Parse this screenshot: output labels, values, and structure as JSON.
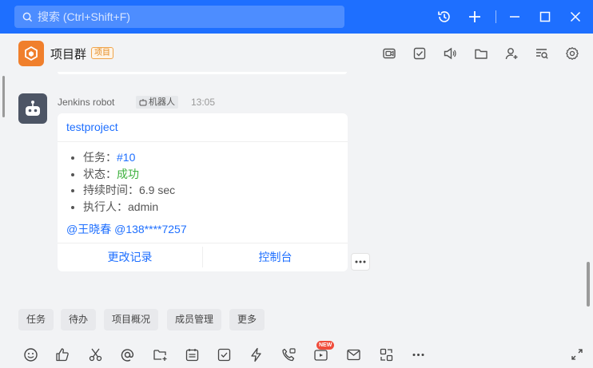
{
  "titlebar": {
    "search_placeholder": "搜索 (Ctrl+Shift+F)",
    "icons": [
      "history-icon",
      "plus-icon",
      "minimize-icon",
      "maximize-icon",
      "close-icon"
    ]
  },
  "header": {
    "group_name": "项目群",
    "group_badge": "项目",
    "icons": [
      "screen-share-icon",
      "task-check-icon",
      "announcement-icon",
      "folder-icon",
      "add-member-icon",
      "search-history-icon",
      "settings-icon"
    ]
  },
  "message": {
    "sender": "Jenkins robot",
    "robot_tag": "机器人",
    "time": "13:05",
    "card": {
      "title": "testproject",
      "items": [
        {
          "label": "任务：",
          "value": "#10"
        },
        {
          "label": "状态：",
          "value": "成功"
        },
        {
          "label": "持续时间：6.9 sec",
          "value": ""
        },
        {
          "label": "执行人：admin",
          "value": ""
        }
      ],
      "mentions": "@王晓春 @138****7257",
      "button_changes": "更改记录",
      "button_console": "控制台"
    },
    "more_label": "···"
  },
  "quick_actions": [
    "任务",
    "待办",
    "项目概况",
    "成员管理",
    "更多"
  ],
  "toolbar": {
    "new_badge": "NEW",
    "more_label": "···"
  },
  "colors": {
    "primary": "#1e6fff",
    "success": "#3eb13e",
    "group_avatar": "#f07f2c",
    "robot_avatar": "#4d5565"
  }
}
